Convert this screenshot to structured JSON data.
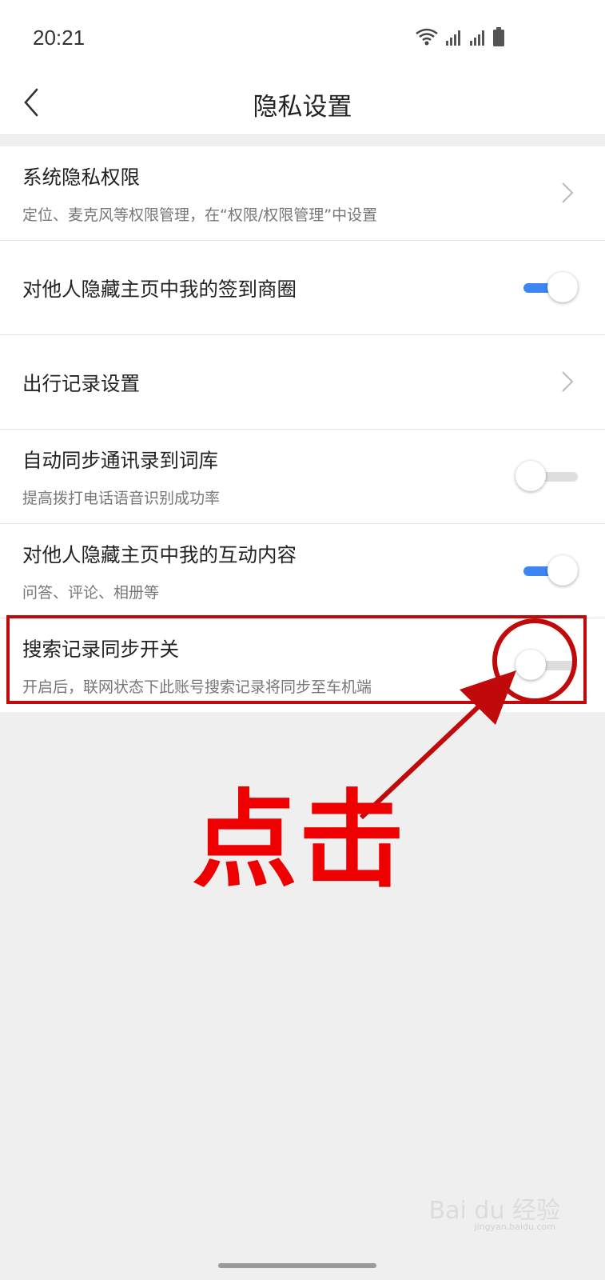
{
  "status_bar": {
    "time": "20:21",
    "icons": [
      "wifi-icon",
      "signal-icon",
      "signal-icon",
      "battery-icon"
    ]
  },
  "nav": {
    "back_icon": "chevron-left-icon",
    "title": "隐私设置"
  },
  "settings": [
    {
      "title": "系统隐私权限",
      "subtitle": "定位、麦克风等权限管理，在“权限/权限管理”中设置",
      "control": "chevron"
    },
    {
      "title": "对他人隐藏主页中我的签到商圈",
      "subtitle": "",
      "control": "toggle",
      "on": true
    },
    {
      "title": "出行记录设置",
      "subtitle": "",
      "control": "chevron"
    },
    {
      "title": "自动同步通讯录到词库",
      "subtitle": "提高拨打电话语音识别成功率",
      "control": "toggle",
      "on": false
    },
    {
      "title": "对他人隐藏主页中我的互动内容",
      "subtitle": "问答、评论、相册等",
      "control": "toggle",
      "on": true
    },
    {
      "title": "搜索记录同步开关",
      "subtitle": "开启后，联网状态下此账号搜索记录将同步至车机端",
      "control": "toggle",
      "on": false
    }
  ],
  "annotation": {
    "label": "点击",
    "color": "#ee0000"
  },
  "watermark": {
    "text": "Bai du 经验",
    "sub": "jingyan.baidu.com"
  },
  "colors": {
    "toggle_on": "#3d86f2",
    "annotation_red": "#c0090b"
  }
}
